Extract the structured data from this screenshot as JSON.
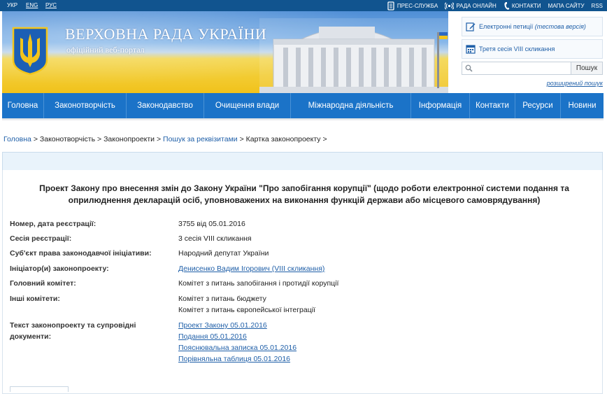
{
  "topbar": {
    "languages": [
      "УКР",
      "ENG",
      "РУС"
    ],
    "links": {
      "press": "ПРЕС-СЛУЖБА",
      "radio": "РАДА ОНЛАЙН",
      "contacts": "КОНТАКТИ",
      "sitemap": "МАПА САЙТУ",
      "rss": "RSS"
    }
  },
  "header": {
    "title": "ВЕРХОВНА РАДА УКРАЇНИ",
    "subtitle": "офіційний веб-портал",
    "petitions": {
      "label": "Електронні петиції",
      "note": "(тестова версія)"
    },
    "session": "Третя сесія VIII скликання",
    "search": {
      "placeholder": "",
      "button": "Пошук",
      "advanced": "розширений пошук"
    }
  },
  "nav": {
    "items": [
      "Головна",
      "Законотворчість",
      "Законодавство",
      "Очищення влади",
      "Міжнародна діяльність",
      "Інформація",
      "Контакти",
      "Ресурси",
      "Новини"
    ]
  },
  "breadcrumb": {
    "home": "Головна",
    "lawmaking": "Законотворчість",
    "bills": "Законопроекти",
    "search": "Пошук за реквізитами",
    "card": "Картка законопроекту",
    "sep": ">"
  },
  "bill": {
    "title": "Проект Закону про внесення змін до Закону України \"Про запобігання корупції\" (щодо роботи електронної системи подання та оприлюднення декларацій осіб, уповноважених на виконання функцій держави або місцевого самоврядування)",
    "fields": [
      {
        "label": "Номер, дата реєстрації:",
        "values": [
          "3755 від 05.01.2016"
        ],
        "link": false
      },
      {
        "label": "Сесія реєстрації:",
        "values": [
          "3 сесія VIII скликання"
        ],
        "link": false
      },
      {
        "label": "Суб'єкт права законодавчої ініціативи:",
        "values": [
          "Народний депутат України"
        ],
        "link": false
      },
      {
        "label": "Ініціатор(и) законопроекту:",
        "values": [
          "Денисенко Вадим Ігорович (VIII скликання)"
        ],
        "link": true
      },
      {
        "label": "Головний комітет:",
        "values": [
          "Комітет з питань запобігання і протидії корупції"
        ],
        "link": false
      },
      {
        "label": "Інші комітети:",
        "values": [
          "Комітет з питань бюджету",
          "Комітет з питань європейської інтеграції"
        ],
        "link": false
      },
      {
        "label": "Текст законопроекту та супровідні документи:",
        "values": [
          "Проект Закону 05.01.2016",
          "Подання 05.01.2016",
          "Пояснювальна записка 05.01.2016",
          "Порівняльна таблиця 05.01.2016"
        ],
        "link": true
      }
    ]
  },
  "colors": {
    "topbar": "#11548f",
    "nav": "#1b73c8",
    "link": "#1f5fa8",
    "panel": "#e9f3fb"
  }
}
